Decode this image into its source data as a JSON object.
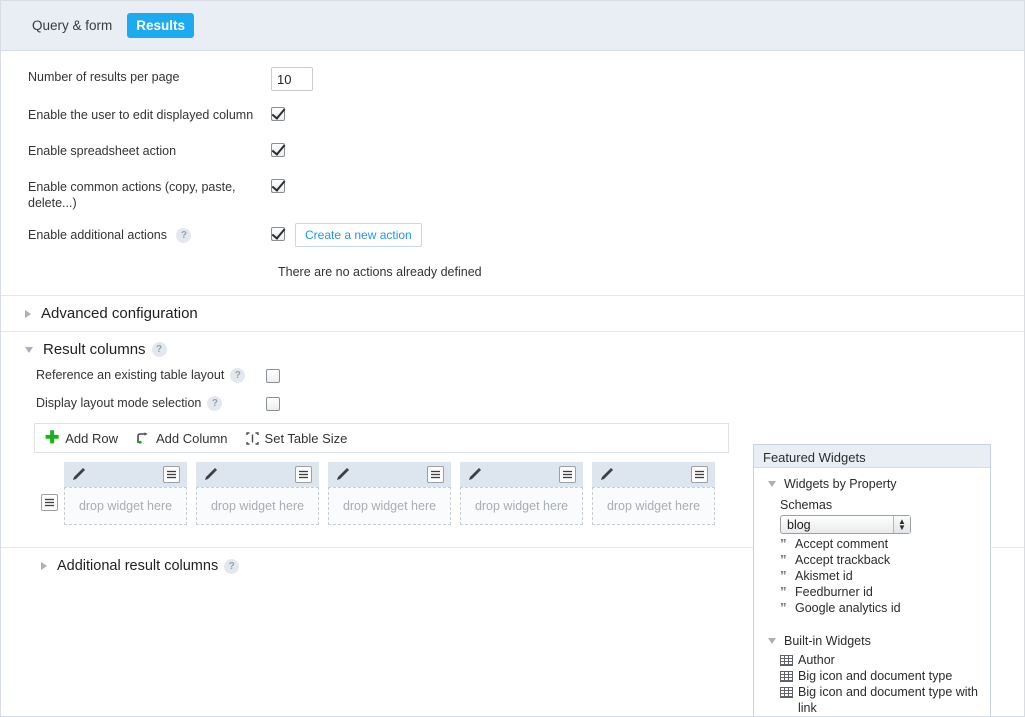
{
  "tabs": [
    {
      "label": "Query & form",
      "active": false
    },
    {
      "label": "Results",
      "active": true
    }
  ],
  "form": {
    "rows": [
      {
        "label": "Number of results per page",
        "type": "number",
        "value": "10"
      },
      {
        "label": "Enable the user to edit displayed column",
        "type": "checkbox",
        "checked": true
      },
      {
        "label": "Enable spreadsheet action",
        "type": "checkbox",
        "checked": true
      },
      {
        "label": "Enable common actions (copy, paste, delete...)",
        "type": "checkbox",
        "checked": true
      },
      {
        "label": "Enable additional actions",
        "type": "checkbox",
        "checked": true,
        "help": "?",
        "button": "Create a new action"
      }
    ],
    "note": "There are no actions already defined"
  },
  "sections": {
    "advanced": {
      "title": "Advanced configuration",
      "expanded": false
    },
    "result_columns": {
      "title": "Result columns",
      "expanded": true,
      "help": "?"
    },
    "additional": {
      "title": "Additional result columns",
      "expanded": false,
      "help": "?"
    }
  },
  "result_columns": {
    "options": [
      {
        "label": "Reference an existing table layout",
        "help": "?",
        "checked": false
      },
      {
        "label": "Display layout mode selection",
        "help": "?",
        "checked": false
      }
    ],
    "toolbar": [
      {
        "label": "Add Row",
        "icon": "plus-icon"
      },
      {
        "label": "Add Column",
        "icon": "add-column-icon"
      },
      {
        "label": "Set Table Size",
        "icon": "set-table-size-icon"
      }
    ],
    "columns": [
      {
        "drop_text": "drop widget here"
      },
      {
        "drop_text": "drop widget here"
      },
      {
        "drop_text": "drop widget here"
      },
      {
        "drop_text": "drop widget here"
      },
      {
        "drop_text": "drop widget here"
      }
    ],
    "row_handle_icon": "hamburger-icon",
    "col_edit_icon": "pencil-icon",
    "col_menu_icon": "hamburger-icon"
  },
  "side_panel": {
    "title": "Featured Widgets",
    "widgets_by_property": {
      "title": "Widgets by Property",
      "expanded": true,
      "schemas_label": "Schemas",
      "schema_selected": "blog",
      "properties": [
        "Accept comment",
        "Accept trackback",
        "Akismet id",
        "Feedburner id",
        "Google analytics id"
      ]
    },
    "built_in_widgets": {
      "title": "Built-in Widgets",
      "expanded": true,
      "items": [
        "Author",
        "Big icon and document type",
        "Big icon and document type with link"
      ]
    }
  },
  "colors": {
    "tab_active_bg": "#1eaaf1",
    "tabbar_bg": "#e9eef4",
    "link": "#2196f3",
    "plus_green": "#19b319",
    "col_head_bg": "#dde5ef"
  }
}
